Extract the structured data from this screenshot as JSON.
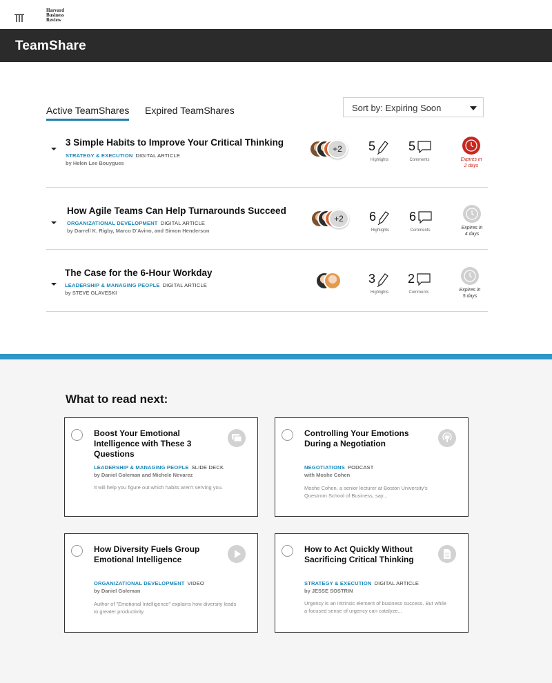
{
  "brand": {
    "logo_text": "Harvard Business Review"
  },
  "header": {
    "title": "TeamShare"
  },
  "tabs": [
    {
      "label": "Active TeamShares",
      "active": true
    },
    {
      "label": "Expired TeamShares",
      "active": false
    }
  ],
  "sort": {
    "label": "Sort by: Expiring Soon"
  },
  "colors": {
    "accent": "#1e7fae",
    "topic": "#1a86b8",
    "expiry_urgent": "#c8271d",
    "header_bg": "#2b2b2b",
    "band": "#2f97c7"
  },
  "shares": [
    {
      "title": "3 Simple Habits to Improve Your Critical Thinking",
      "topic": "Strategy & Execution",
      "type": "Digital Article",
      "authors": "by Helen Lee Bouygues",
      "avatars_more": "+2",
      "highlights": "5",
      "highlights_label": "Highlights",
      "comments": "5",
      "comments_label": "Comments",
      "expiry": "Expires in 2 days",
      "urgent": true
    },
    {
      "title": "How Agile Teams Can Help Turnarounds Succeed",
      "topic": "Organizational Development",
      "type": "Digital Article",
      "authors": "by Darrell K. Rigby, Marco D'Avino, and Simon Henderson",
      "avatars_more": "+2",
      "highlights": "6",
      "highlights_label": "Highlights",
      "comments": "6",
      "comments_label": "Comments",
      "expiry": "Expires in 4 days",
      "urgent": false
    },
    {
      "title": "The Case for the 6-Hour Workday",
      "topic": "Leadership & Managing People",
      "type": "Digital Article",
      "authors": "by STEVE GLAVESKI",
      "avatars_more": "",
      "highlights": "3",
      "highlights_label": "Highlights",
      "comments": "2",
      "comments_label": "Comments",
      "expiry": "Expires in 5 days",
      "urgent": false
    }
  ],
  "next": {
    "heading": "What to read next:",
    "cards": [
      {
        "title": "Boost Your Emotional Intelligence with These 3 Questions",
        "topic": "Leadership & Managing People",
        "type": "Slide Deck",
        "author": "by Daniel Goleman and Michele Nevarez",
        "snippet": "It will help you figure out which habits aren't serving you.",
        "icon": "slide-deck-icon"
      },
      {
        "title": "Controlling Your Emotions During a Negotiation",
        "topic": "Negotiations",
        "type": "Podcast",
        "author": "with Moshe Cohen",
        "snippet": "Moshe Cohen, a senior lecturer at Boston University's Questrom School of Business, say...",
        "icon": "podcast-icon"
      },
      {
        "title": "How Diversity Fuels Group Emotional Intelligence",
        "topic": "Organizational Development",
        "type": "Video",
        "author": "by Daniel Goleman",
        "snippet": "Author of \"Emotional Intelligence\" explains how diversity leads to greater productivity.",
        "icon": "video-play-icon"
      },
      {
        "title": "How to Act Quickly Without Sacrificing Critical Thinking",
        "topic": "Strategy & Execution",
        "type": "Digital Article",
        "author": "by JESSE SOSTRIN",
        "snippet": "Urgency is an intrinsic element of business success. But while a focused sense of urgency can catalyze...",
        "icon": "article-icon"
      }
    ]
  }
}
